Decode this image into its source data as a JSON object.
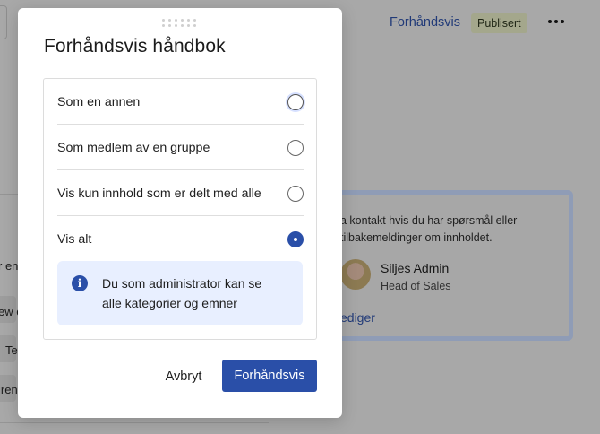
{
  "background": {
    "header": {
      "preview_link": "Forhåndsvis",
      "status_badge": "Publisert",
      "more_icon": "more-horizontal-icon"
    },
    "left_fragments": [
      "r en",
      "ew e",
      "Te",
      "iren"
    ],
    "contact_card": {
      "text": "a kontakt hvis du har spørsmål eller\ntilbakemeldinger om innholdet.",
      "person_name": "Siljes Admin",
      "person_title": "Head of Sales",
      "edit_link": "ediger"
    }
  },
  "modal": {
    "title": "Forhåndsvis håndbok",
    "options": [
      {
        "label": "Som en annen",
        "selected": false,
        "focused": true
      },
      {
        "label": "Som medlem av en gruppe",
        "selected": false,
        "focused": false
      },
      {
        "label": "Vis kun innhold som er delt med alle",
        "selected": false,
        "focused": false
      },
      {
        "label": "Vis alt",
        "selected": true,
        "focused": false
      }
    ],
    "info": {
      "icon": "info-icon",
      "text": "Du som administrator kan se alle kategorier og emner"
    },
    "buttons": {
      "cancel": "Avbryt",
      "confirm": "Forhåndsvis"
    }
  },
  "colors": {
    "accent": "#2a4fa8",
    "info_bg": "#e8efff",
    "overlay": "#a8a8a8"
  }
}
